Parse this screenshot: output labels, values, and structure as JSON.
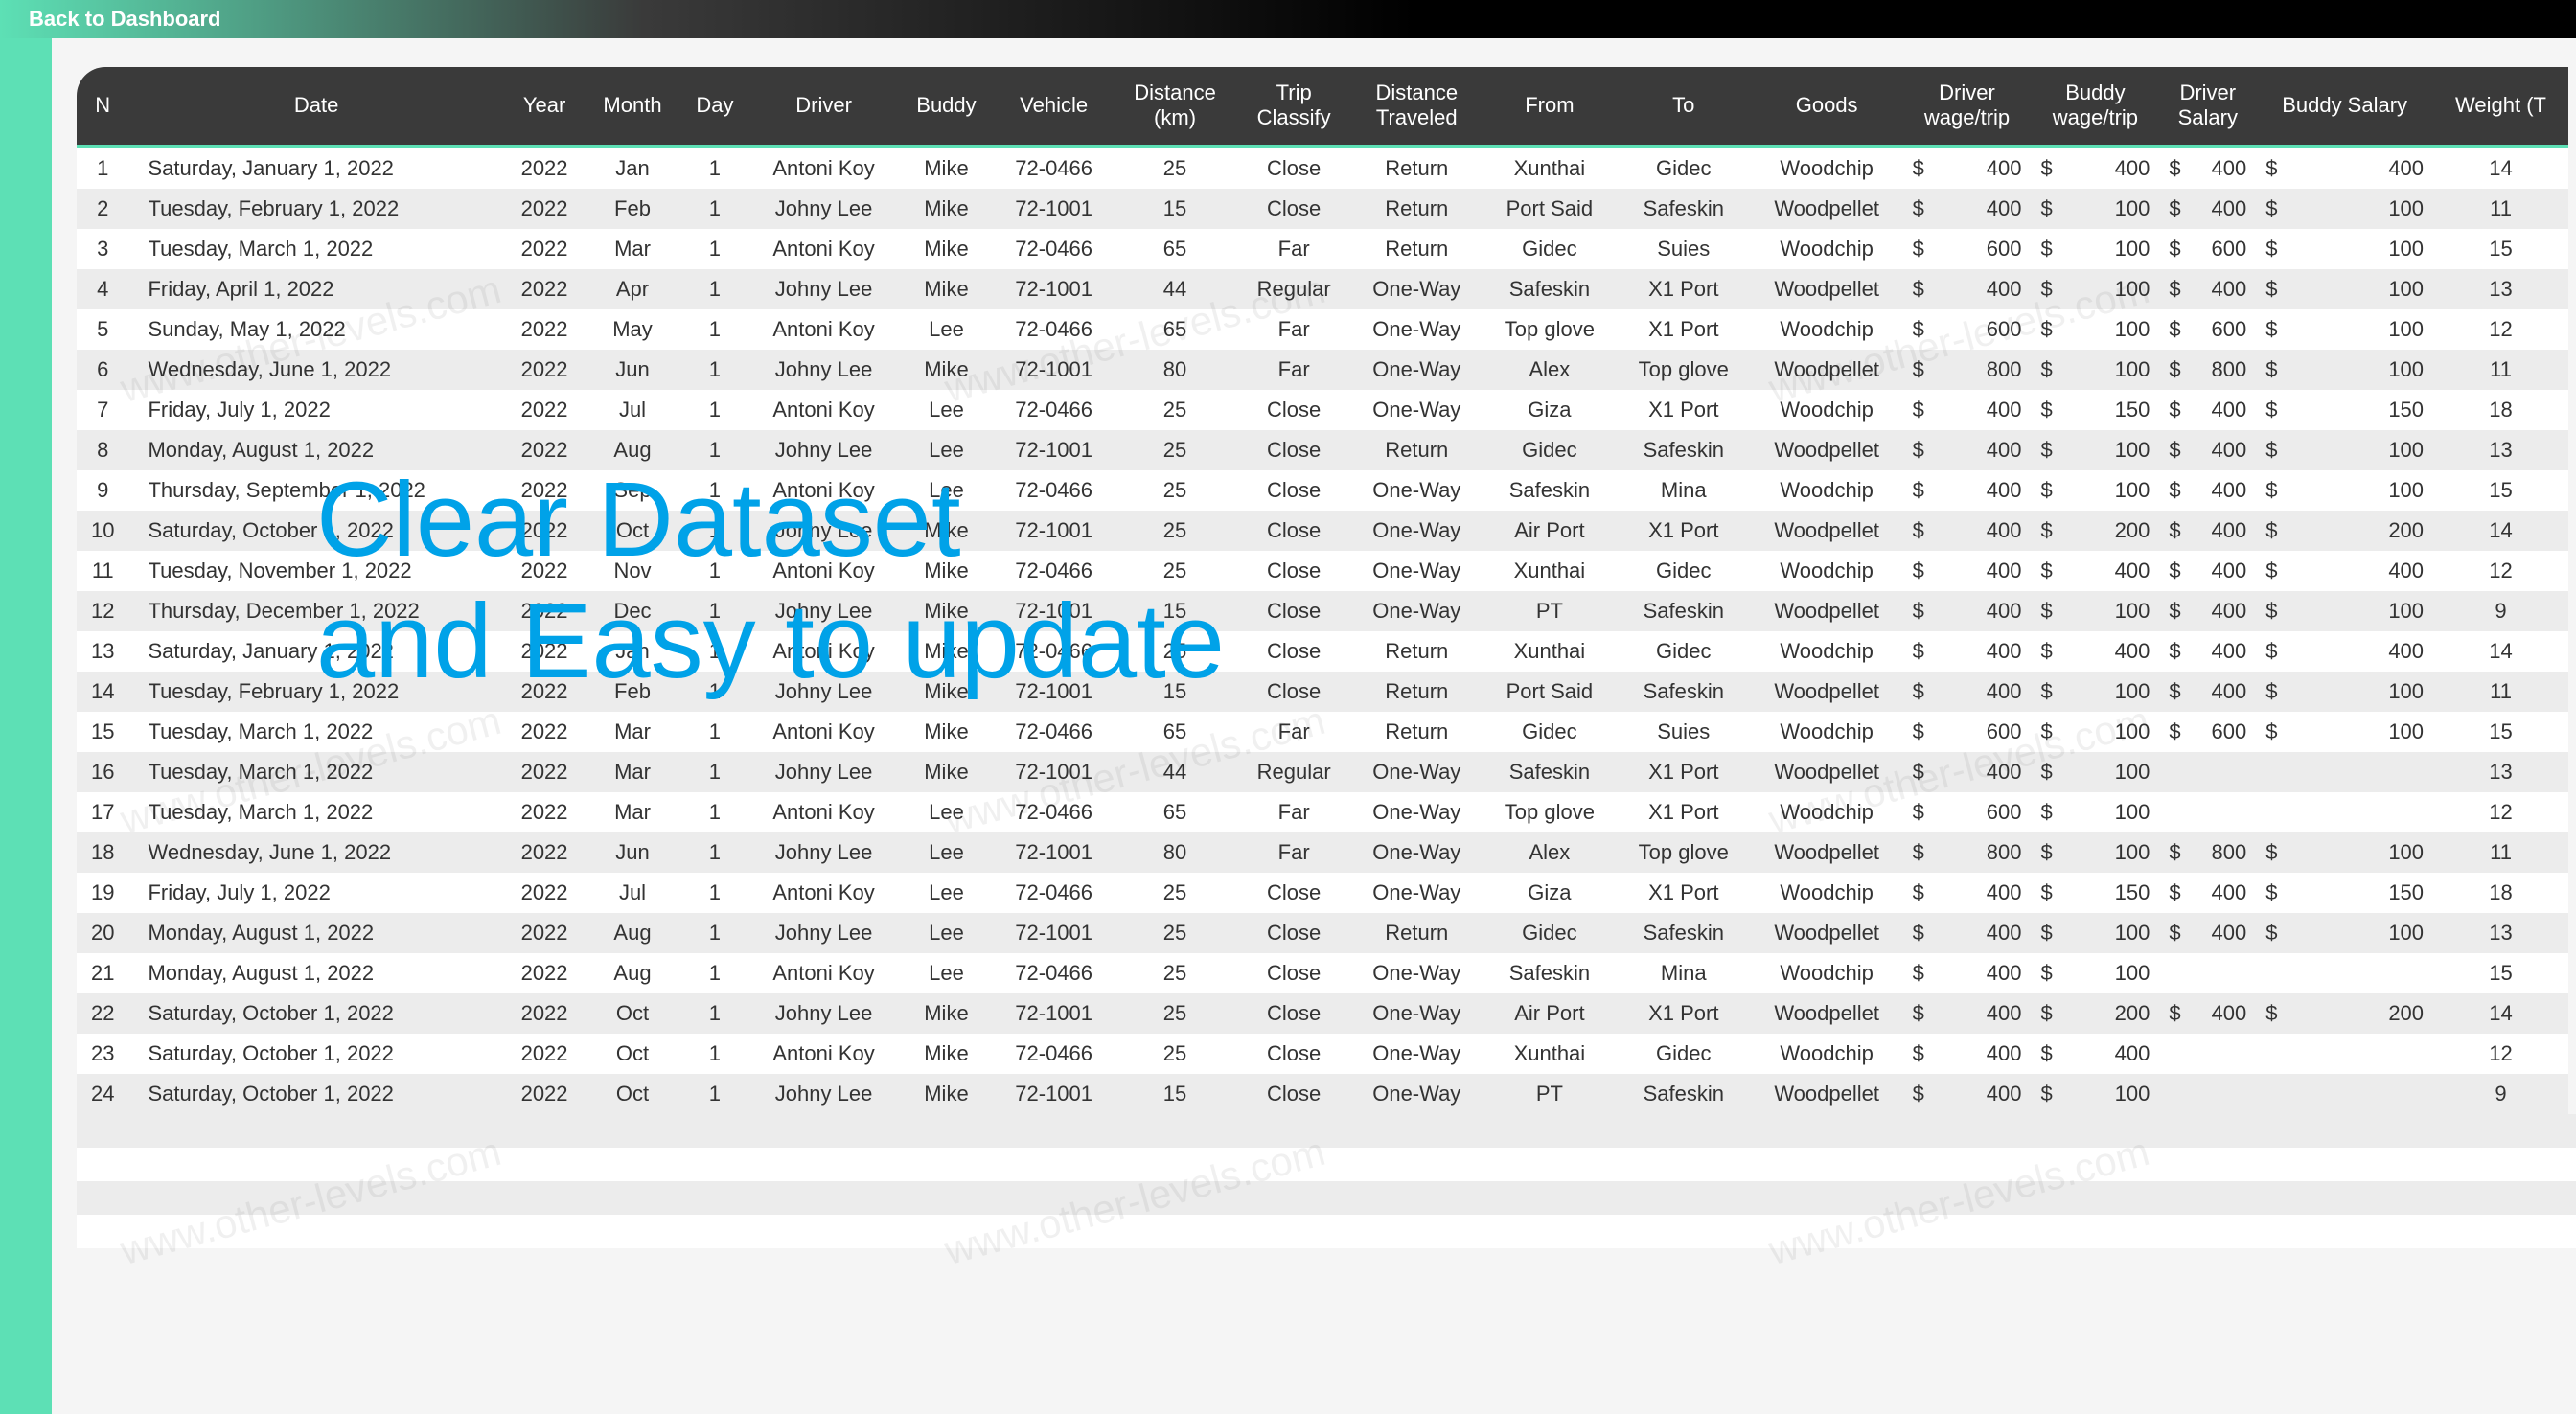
{
  "topbar": {
    "back_label": "Back to Dashboard"
  },
  "overlay": {
    "line1": "Clear Dataset",
    "line2": "and Easy to update"
  },
  "watermark": "www.other-levels.com",
  "table": {
    "headers": [
      "N",
      "Date",
      "Year",
      "Month",
      "Day",
      "Driver",
      "Buddy",
      "Vehicle",
      "Distance (km)",
      "Trip Classify",
      "Distance Traveled",
      "From",
      "To",
      "Goods",
      "Driver wage/trip",
      "Buddy wage/trip",
      "Driver Salary",
      "Buddy Salary",
      "Weight (T"
    ],
    "rows": [
      {
        "n": 1,
        "date": "Saturday, January 1, 2022",
        "year": 2022,
        "month": "Jan",
        "day": 1,
        "driver": "Antoni Koy",
        "buddy": "Mike",
        "vehicle": "72-0466",
        "dist": 25,
        "classify": "Close",
        "traveled": "Return",
        "from": "Xunthai",
        "to": "Gidec",
        "goods": "Woodchip",
        "dwage": "400",
        "bwage": "400",
        "dsal": "400",
        "bsal": "400",
        "weight": "14"
      },
      {
        "n": 2,
        "date": "Tuesday, February 1, 2022",
        "year": 2022,
        "month": "Feb",
        "day": 1,
        "driver": "Johny Lee",
        "buddy": "Mike",
        "vehicle": "72-1001",
        "dist": 15,
        "classify": "Close",
        "traveled": "Return",
        "from": "Port Said",
        "to": "Safeskin",
        "goods": "Woodpellet",
        "dwage": "400",
        "bwage": "100",
        "dsal": "400",
        "bsal": "100",
        "weight": "11"
      },
      {
        "n": 3,
        "date": "Tuesday, March 1, 2022",
        "year": 2022,
        "month": "Mar",
        "day": 1,
        "driver": "Antoni Koy",
        "buddy": "Mike",
        "vehicle": "72-0466",
        "dist": 65,
        "classify": "Far",
        "traveled": "Return",
        "from": "Gidec",
        "to": "Suies",
        "goods": "Woodchip",
        "dwage": "600",
        "bwage": "100",
        "dsal": "600",
        "bsal": "100",
        "weight": "15"
      },
      {
        "n": 4,
        "date": "Friday, April 1, 2022",
        "year": 2022,
        "month": "Apr",
        "day": 1,
        "driver": "Johny Lee",
        "buddy": "Mike",
        "vehicle": "72-1001",
        "dist": 44,
        "classify": "Regular",
        "traveled": "One-Way",
        "from": "Safeskin",
        "to": "X1 Port",
        "goods": "Woodpellet",
        "dwage": "400",
        "bwage": "100",
        "dsal": "400",
        "bsal": "100",
        "weight": "13"
      },
      {
        "n": 5,
        "date": "Sunday, May 1, 2022",
        "year": 2022,
        "month": "May",
        "day": 1,
        "driver": "Antoni Koy",
        "buddy": "Lee",
        "vehicle": "72-0466",
        "dist": 65,
        "classify": "Far",
        "traveled": "One-Way",
        "from": "Top glove",
        "to": "X1 Port",
        "goods": "Woodchip",
        "dwage": "600",
        "bwage": "100",
        "dsal": "600",
        "bsal": "100",
        "weight": "12"
      },
      {
        "n": 6,
        "date": "Wednesday, June 1, 2022",
        "year": 2022,
        "month": "Jun",
        "day": 1,
        "driver": "Johny Lee",
        "buddy": "Mike",
        "vehicle": "72-1001",
        "dist": 80,
        "classify": "Far",
        "traveled": "One-Way",
        "from": "Alex",
        "to": "Top glove",
        "goods": "Woodpellet",
        "dwage": "800",
        "bwage": "100",
        "dsal": "800",
        "bsal": "100",
        "weight": "11"
      },
      {
        "n": 7,
        "date": "Friday, July 1, 2022",
        "year": 2022,
        "month": "Jul",
        "day": 1,
        "driver": "Antoni Koy",
        "buddy": "Lee",
        "vehicle": "72-0466",
        "dist": 25,
        "classify": "Close",
        "traveled": "One-Way",
        "from": "Giza",
        "to": "X1 Port",
        "goods": "Woodchip",
        "dwage": "400",
        "bwage": "150",
        "dsal": "400",
        "bsal": "150",
        "weight": "18"
      },
      {
        "n": 8,
        "date": "Monday, August 1, 2022",
        "year": 2022,
        "month": "Aug",
        "day": 1,
        "driver": "Johny Lee",
        "buddy": "Lee",
        "vehicle": "72-1001",
        "dist": 25,
        "classify": "Close",
        "traveled": "Return",
        "from": "Gidec",
        "to": "Safeskin",
        "goods": "Woodpellet",
        "dwage": "400",
        "bwage": "100",
        "dsal": "400",
        "bsal": "100",
        "weight": "13"
      },
      {
        "n": 9,
        "date": "Thursday, September 1, 2022",
        "year": 2022,
        "month": "Sep",
        "day": 1,
        "driver": "Antoni Koy",
        "buddy": "Lee",
        "vehicle": "72-0466",
        "dist": 25,
        "classify": "Close",
        "traveled": "One-Way",
        "from": "Safeskin",
        "to": "Mina",
        "goods": "Woodchip",
        "dwage": "400",
        "bwage": "100",
        "dsal": "400",
        "bsal": "100",
        "weight": "15"
      },
      {
        "n": 10,
        "date": "Saturday, October 1, 2022",
        "year": 2022,
        "month": "Oct",
        "day": 1,
        "driver": "Johny Lee",
        "buddy": "Mike",
        "vehicle": "72-1001",
        "dist": 25,
        "classify": "Close",
        "traveled": "One-Way",
        "from": "Air Port",
        "to": "X1 Port",
        "goods": "Woodpellet",
        "dwage": "400",
        "bwage": "200",
        "dsal": "400",
        "bsal": "200",
        "weight": "14"
      },
      {
        "n": 11,
        "date": "Tuesday, November 1, 2022",
        "year": 2022,
        "month": "Nov",
        "day": 1,
        "driver": "Antoni Koy",
        "buddy": "Mike",
        "vehicle": "72-0466",
        "dist": 25,
        "classify": "Close",
        "traveled": "One-Way",
        "from": "Xunthai",
        "to": "Gidec",
        "goods": "Woodchip",
        "dwage": "400",
        "bwage": "400",
        "dsal": "400",
        "bsal": "400",
        "weight": "12"
      },
      {
        "n": 12,
        "date": "Thursday, December 1, 2022",
        "year": 2022,
        "month": "Dec",
        "day": 1,
        "driver": "Johny Lee",
        "buddy": "Mike",
        "vehicle": "72-1001",
        "dist": 15,
        "classify": "Close",
        "traveled": "One-Way",
        "from": "PT",
        "to": "Safeskin",
        "goods": "Woodpellet",
        "dwage": "400",
        "bwage": "100",
        "dsal": "400",
        "bsal": "100",
        "weight": "9"
      },
      {
        "n": 13,
        "date": "Saturday, January 1, 2022",
        "year": 2022,
        "month": "Jan",
        "day": 1,
        "driver": "Antoni Koy",
        "buddy": "Mike",
        "vehicle": "72-0466",
        "dist": 25,
        "classify": "Close",
        "traveled": "Return",
        "from": "Xunthai",
        "to": "Gidec",
        "goods": "Woodchip",
        "dwage": "400",
        "bwage": "400",
        "dsal": "400",
        "bsal": "400",
        "weight": "14"
      },
      {
        "n": 14,
        "date": "Tuesday, February 1, 2022",
        "year": 2022,
        "month": "Feb",
        "day": 1,
        "driver": "Johny Lee",
        "buddy": "Mike",
        "vehicle": "72-1001",
        "dist": 15,
        "classify": "Close",
        "traveled": "Return",
        "from": "Port Said",
        "to": "Safeskin",
        "goods": "Woodpellet",
        "dwage": "400",
        "bwage": "100",
        "dsal": "400",
        "bsal": "100",
        "weight": "11"
      },
      {
        "n": 15,
        "date": "Tuesday, March 1, 2022",
        "year": 2022,
        "month": "Mar",
        "day": 1,
        "driver": "Antoni Koy",
        "buddy": "Mike",
        "vehicle": "72-0466",
        "dist": 65,
        "classify": "Far",
        "traveled": "Return",
        "from": "Gidec",
        "to": "Suies",
        "goods": "Woodchip",
        "dwage": "600",
        "bwage": "100",
        "dsal": "600",
        "bsal": "100",
        "weight": "15"
      },
      {
        "n": 16,
        "date": "Tuesday, March 1, 2022",
        "year": 2022,
        "month": "Mar",
        "day": 1,
        "driver": "Johny Lee",
        "buddy": "Mike",
        "vehicle": "72-1001",
        "dist": 44,
        "classify": "Regular",
        "traveled": "One-Way",
        "from": "Safeskin",
        "to": "X1 Port",
        "goods": "Woodpellet",
        "dwage": "400",
        "bwage": "100",
        "dsal": "",
        "bsal": "",
        "weight": "13"
      },
      {
        "n": 17,
        "date": "Tuesday, March 1, 2022",
        "year": 2022,
        "month": "Mar",
        "day": 1,
        "driver": "Antoni Koy",
        "buddy": "Lee",
        "vehicle": "72-0466",
        "dist": 65,
        "classify": "Far",
        "traveled": "One-Way",
        "from": "Top glove",
        "to": "X1 Port",
        "goods": "Woodchip",
        "dwage": "600",
        "bwage": "100",
        "dsal": "",
        "bsal": "",
        "weight": "12"
      },
      {
        "n": 18,
        "date": "Wednesday, June 1, 2022",
        "year": 2022,
        "month": "Jun",
        "day": 1,
        "driver": "Johny Lee",
        "buddy": "Lee",
        "vehicle": "72-1001",
        "dist": 80,
        "classify": "Far",
        "traveled": "One-Way",
        "from": "Alex",
        "to": "Top glove",
        "goods": "Woodpellet",
        "dwage": "800",
        "bwage": "100",
        "dsal": "800",
        "bsal": "100",
        "weight": "11"
      },
      {
        "n": 19,
        "date": "Friday, July 1, 2022",
        "year": 2022,
        "month": "Jul",
        "day": 1,
        "driver": "Antoni Koy",
        "buddy": "Lee",
        "vehicle": "72-0466",
        "dist": 25,
        "classify": "Close",
        "traveled": "One-Way",
        "from": "Giza",
        "to": "X1 Port",
        "goods": "Woodchip",
        "dwage": "400",
        "bwage": "150",
        "dsal": "400",
        "bsal": "150",
        "weight": "18"
      },
      {
        "n": 20,
        "date": "Monday, August 1, 2022",
        "year": 2022,
        "month": "Aug",
        "day": 1,
        "driver": "Johny Lee",
        "buddy": "Lee",
        "vehicle": "72-1001",
        "dist": 25,
        "classify": "Close",
        "traveled": "Return",
        "from": "Gidec",
        "to": "Safeskin",
        "goods": "Woodpellet",
        "dwage": "400",
        "bwage": "100",
        "dsal": "400",
        "bsal": "100",
        "weight": "13"
      },
      {
        "n": 21,
        "date": "Monday, August 1, 2022",
        "year": 2022,
        "month": "Aug",
        "day": 1,
        "driver": "Antoni Koy",
        "buddy": "Lee",
        "vehicle": "72-0466",
        "dist": 25,
        "classify": "Close",
        "traveled": "One-Way",
        "from": "Safeskin",
        "to": "Mina",
        "goods": "Woodchip",
        "dwage": "400",
        "bwage": "100",
        "dsal": "",
        "bsal": "",
        "weight": "15"
      },
      {
        "n": 22,
        "date": "Saturday, October 1, 2022",
        "year": 2022,
        "month": "Oct",
        "day": 1,
        "driver": "Johny Lee",
        "buddy": "Mike",
        "vehicle": "72-1001",
        "dist": 25,
        "classify": "Close",
        "traveled": "One-Way",
        "from": "Air Port",
        "to": "X1 Port",
        "goods": "Woodpellet",
        "dwage": "400",
        "bwage": "200",
        "dsal": "400",
        "bsal": "200",
        "weight": "14"
      },
      {
        "n": 23,
        "date": "Saturday, October 1, 2022",
        "year": 2022,
        "month": "Oct",
        "day": 1,
        "driver": "Antoni Koy",
        "buddy": "Mike",
        "vehicle": "72-0466",
        "dist": 25,
        "classify": "Close",
        "traveled": "One-Way",
        "from": "Xunthai",
        "to": "Gidec",
        "goods": "Woodchip",
        "dwage": "400",
        "bwage": "400",
        "dsal": "",
        "bsal": "",
        "weight": "12"
      },
      {
        "n": 24,
        "date": "Saturday, October 1, 2022",
        "year": 2022,
        "month": "Oct",
        "day": 1,
        "driver": "Johny Lee",
        "buddy": "Mike",
        "vehicle": "72-1001",
        "dist": 15,
        "classify": "Close",
        "traveled": "One-Way",
        "from": "PT",
        "to": "Safeskin",
        "goods": "Woodpellet",
        "dwage": "400",
        "bwage": "100",
        "dsal": "",
        "bsal": "",
        "weight": "9"
      }
    ]
  }
}
